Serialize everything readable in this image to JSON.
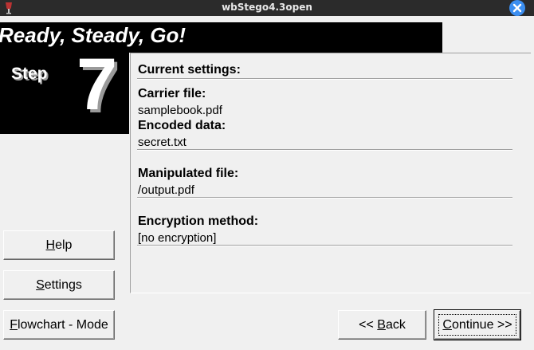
{
  "window": {
    "title": "wbStego4.3open",
    "close_icon": "close-icon"
  },
  "banner": {
    "text": "Ready, Steady, Go!"
  },
  "step": {
    "label": "Step",
    "number": "7"
  },
  "settings": {
    "heading": "Current settings:",
    "carrier_label": "Carrier file:",
    "carrier_value": "samplebook.pdf",
    "encoded_label": "Encoded data:",
    "encoded_value": "secret.txt",
    "manipulated_label": "Manipulated file:",
    "manipulated_value": "/output.pdf",
    "encryption_label": "Encryption method:",
    "encryption_value": "[no encryption]"
  },
  "buttons": {
    "help": {
      "label": "Help",
      "mnemonic": "H",
      "rest": "elp"
    },
    "settings": {
      "label": "Settings",
      "mnemonic": "S",
      "rest": "ettings"
    },
    "flowchart": {
      "label": "Flowchart - Mode",
      "mnemonic": "F",
      "rest": "lowchart - Mode"
    },
    "back": {
      "label": "<< Back",
      "prefix": "<< ",
      "mnemonic": "B",
      "rest": "ack"
    },
    "continue": {
      "label": "Continue >>",
      "mnemonic": "C",
      "rest": "ontinue >>"
    }
  },
  "colors": {
    "titlebar": "#2b2b2b",
    "close": "#3b8ef0",
    "banner": "#000000",
    "face": "#f0f0f0"
  }
}
